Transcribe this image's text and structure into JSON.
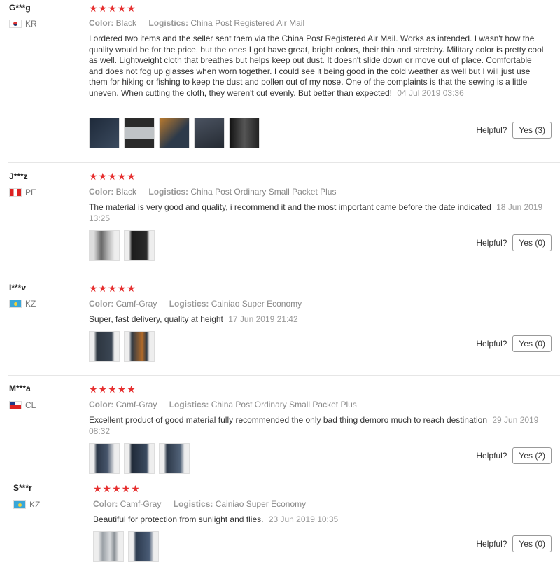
{
  "labels": {
    "color": "Color:",
    "logistics": "Logistics:",
    "helpful": "Helpful?"
  },
  "stars": "★★★★★",
  "reviews": [
    {
      "user": "G***g",
      "country": "KR",
      "color": "Black",
      "logistics": "China Post Registered Air Mail",
      "text": "I ordered two items and the seller sent them via the China Post Registered Air Mail. Works as intended. I wasn't how the quality would be for the price, but the ones I got have great, bright colors, their thin and stretchy. Military color is pretty cool as well. Lightweight cloth that breathes but helps keep out dust. It doesn't slide down or move out of place. Comfortable and does not fog up glasses when worn together. I could see it being good in the cold weather as well but I will just use them for hiking or fishing to keep the dust and pollen out of my nose. One of the complaints is that the sewing is a little uneven. When cutting the cloth, they weren't cut evenly. But better than expected!",
      "date": "04 Jul 2019 03:36",
      "yes": "Yes (3)"
    },
    {
      "user": "J***z",
      "country": "PE",
      "color": "Black",
      "logistics": "China Post Ordinary Small Packet Plus",
      "text": "The material is very good and quality, i recommend it and the most important came before the date indicated",
      "date": "18 Jun 2019 13:25",
      "yes": "Yes (0)"
    },
    {
      "user": "I***v",
      "country": "KZ",
      "color": "Camf-Gray",
      "logistics": "Cainiao Super Economy",
      "text": "Super, fast delivery, quality at height",
      "date": "17 Jun 2019 21:42",
      "yes": "Yes (0)"
    },
    {
      "user": "M***a",
      "country": "CL",
      "color": "Camf-Gray",
      "logistics": "China Post Ordinary Small Packet Plus",
      "text": "Excellent product of good material fully recommended the only bad thing demoro much to reach destination",
      "date": "29 Jun 2019 08:32",
      "yes": "Yes (2)"
    },
    {
      "user": "S***r",
      "country": "KZ",
      "color": "Camf-Gray",
      "logistics": "Cainiao Super Economy",
      "text": "Beautiful for protection from sunlight and flies.",
      "date": "23 Jun 2019 10:35",
      "yes": "Yes (0)"
    }
  ]
}
